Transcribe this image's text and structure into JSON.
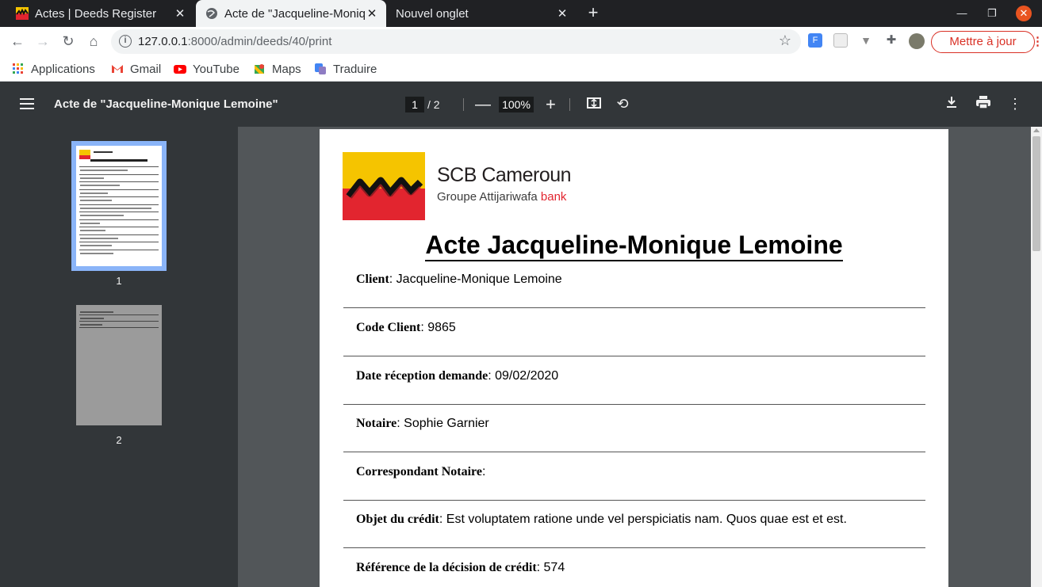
{
  "tabs": [
    {
      "title": "Actes | Deeds Register"
    },
    {
      "title": "Acte de \"Jacqueline-Monique Lemoine\""
    },
    {
      "title": "Nouvel onglet"
    }
  ],
  "address_bar": {
    "host": "127.0.0.1",
    "path": ":8000/admin/deeds/40/print"
  },
  "update_button": "Mettre à jour",
  "bookmarks": [
    {
      "label": "Applications",
      "icon": "apps-grid-icon"
    },
    {
      "label": "Gmail",
      "icon": "gmail-icon"
    },
    {
      "label": "YouTube",
      "icon": "youtube-icon"
    },
    {
      "label": "Maps",
      "icon": "maps-icon"
    },
    {
      "label": "Traduire",
      "icon": "translate-icon"
    }
  ],
  "pdf_viewer": {
    "title": "Acte de \"Jacqueline-Monique Lemoine\"",
    "current_page": "1",
    "total_pages": "/  2",
    "zoom": "100%",
    "thumbnails": [
      "1",
      "2"
    ]
  },
  "document": {
    "brand_name": "SCB Cameroun",
    "brand_group": "Groupe Attijariwafa",
    "brand_bank": "bank",
    "title": "Acte Jacqueline-Monique Lemoine",
    "fields": [
      {
        "label": "Client",
        "value": ": Jacqueline-Monique Lemoine"
      },
      {
        "label": "Code Client",
        "value": ": 9865"
      },
      {
        "label": "Date réception demande",
        "value": ": 09/02/2020"
      },
      {
        "label": "Notaire",
        "value": ": Sophie Garnier"
      },
      {
        "label": "Correspondant Notaire",
        "value": ":"
      },
      {
        "label": "Objet du crédit",
        "value": ": Est voluptatem ratione unde vel perspiciatis nam. Quos quae est et est."
      },
      {
        "label": "Référence de la décision de crédit",
        "value": ": 574"
      }
    ]
  },
  "colors": {
    "tabstrip": "#202124",
    "pdf_toolbar": "#323639",
    "viewer_bg": "#525659",
    "update_red": "#d93025",
    "brand_red": "#e2252f",
    "brand_yellow": "#f5c400"
  }
}
